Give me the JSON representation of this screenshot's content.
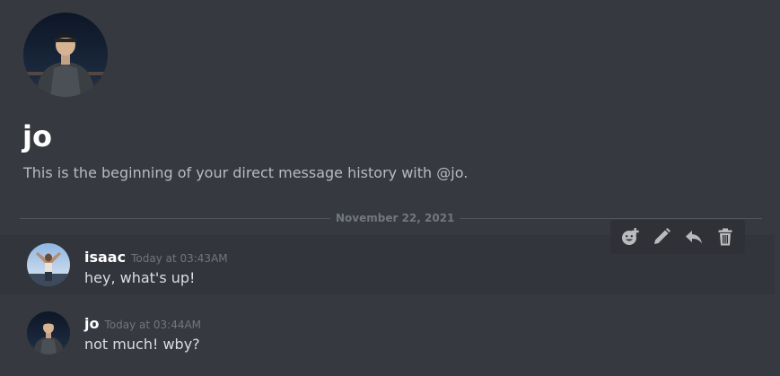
{
  "channel": {
    "name": "jo",
    "intro": "This is the beginning of your direct message history with @jo."
  },
  "divider": {
    "date": "November 22, 2021"
  },
  "messages": [
    {
      "author": "isaac",
      "timestamp": "Today at 03:43AM",
      "text": "hey, what's up!"
    },
    {
      "author": "jo",
      "timestamp": "Today at 03:44AM",
      "text": "not much! wby?"
    }
  ],
  "toolbar": {
    "icons": [
      "add-reaction-icon",
      "edit-icon",
      "reply-icon",
      "delete-icon"
    ]
  },
  "colors": {
    "background": "#36393f",
    "hover_background": "#32353b",
    "toolbar_background": "#2f3136",
    "text": "#dcddde",
    "muted": "#72767d",
    "divider": "#4f545c"
  }
}
